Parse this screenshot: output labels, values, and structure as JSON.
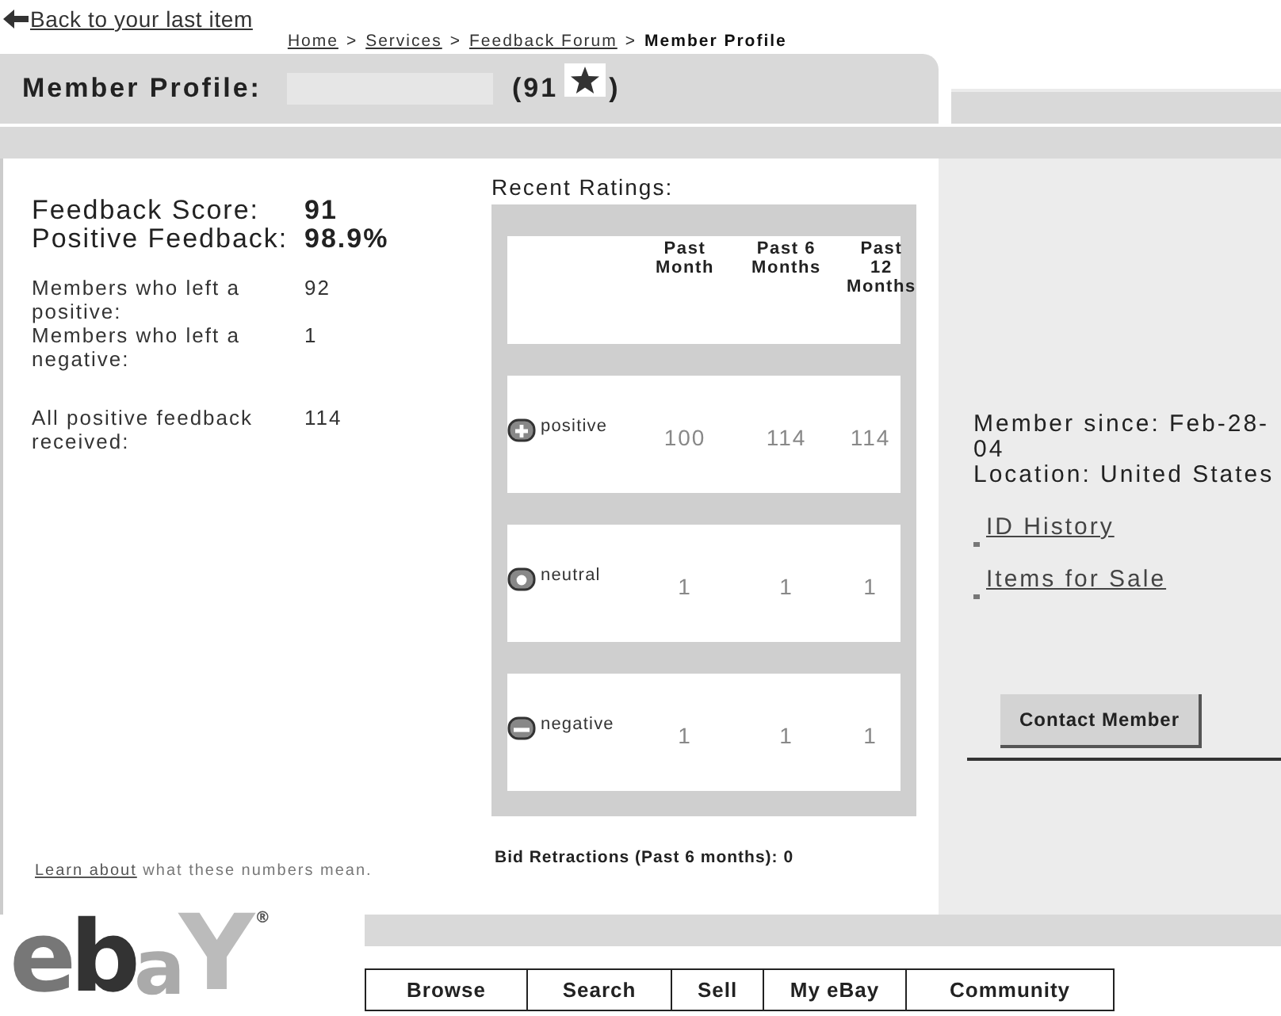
{
  "back_link": "Back to your last item",
  "breadcrumb": [
    {
      "label": "Home",
      "kind": "link"
    },
    {
      "label": "Services",
      "kind": "link",
      "sep": ">"
    },
    {
      "label": "Feedback Forum",
      "kind": "link",
      "sep": ">"
    },
    {
      "label": "Member Profile",
      "kind": "current",
      "sep": ">"
    }
  ],
  "header": {
    "title": "Member Profile:",
    "score_open": "(91",
    "score_close": ")"
  },
  "summary": [
    {
      "label": "Feedback Score:",
      "value": "91",
      "kind": "major"
    },
    {
      "label": "Positive Feedback:",
      "value": "98.9%",
      "kind": "major"
    },
    {
      "label": "Members who left a positive:",
      "value": "92",
      "kind": "minor"
    },
    {
      "label": "Members who left a negative:",
      "value": "1",
      "kind": "minor"
    },
    {
      "label": "All positive feedback received:",
      "value": "114",
      "kind": "minor"
    }
  ],
  "ratings": {
    "title": "Recent Ratings:",
    "columns": [
      "Past Month",
      "Past 6 Months",
      "Past 12 Months"
    ],
    "rows": [
      {
        "kind": "positive",
        "label": "positive",
        "values": [
          "100",
          "114",
          "114"
        ]
      },
      {
        "kind": "neutral",
        "label": "neutral",
        "values": [
          "1",
          "1",
          "1"
        ]
      },
      {
        "kind": "negative",
        "label": "negative",
        "values": [
          "1",
          "1",
          "1"
        ]
      }
    ]
  },
  "learn_more": {
    "link": "Learn about",
    "text": " what these numbers mean."
  },
  "bid_retractions": "Bid Retractions (Past 6 months): 0",
  "member_info": {
    "since": "Member since: Feb-28-04",
    "location": "Location: United States"
  },
  "links": [
    "ID History",
    "Items for Sale"
  ],
  "contact_button": "Contact Member",
  "logo": {
    "letters": [
      "e",
      "b",
      "a",
      "Y"
    ],
    "mark": "®"
  },
  "nav": [
    "Browse",
    "Search",
    "Sell",
    "My eBay",
    "Community"
  ]
}
